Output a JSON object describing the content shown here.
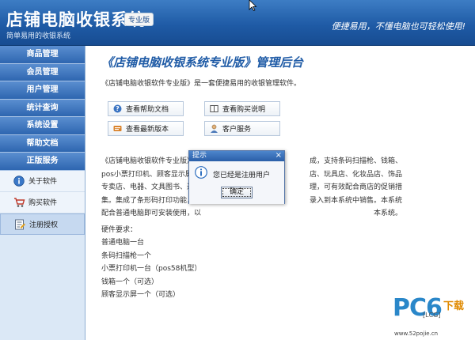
{
  "header": {
    "title": "店铺电脑收银系统",
    "edition": "专业版",
    "subtitle": "简单易用的收银系统",
    "slogan": "便捷易用，不懂电脑也可轻松使用!"
  },
  "sidebar": {
    "items": [
      {
        "label": "商品管理"
      },
      {
        "label": "会员管理"
      },
      {
        "label": "用户管理"
      },
      {
        "label": "统计查询"
      },
      {
        "label": "系统设置"
      },
      {
        "label": "帮助文档"
      },
      {
        "label": "正版服务"
      }
    ],
    "sub_items": [
      {
        "label": "关于软件",
        "icon": "info-icon"
      },
      {
        "label": "购买软件",
        "icon": "cart-icon"
      },
      {
        "label": "注册授权",
        "icon": "register-icon",
        "active": true
      }
    ]
  },
  "main": {
    "heading": "《店铺电脑收银系统专业版》管理后台",
    "intro": "《店铺电脑收银软件专业版》是一套便捷易用的收银管理软件。",
    "buttons": [
      {
        "label": "查看帮助文档",
        "icon": "help-doc-icon"
      },
      {
        "label": "查看购买说明",
        "icon": "book-icon"
      },
      {
        "label": "查看最新版本",
        "icon": "version-icon"
      },
      {
        "label": "客户服务",
        "icon": "customer-service-icon"
      }
    ],
    "description": [
      "《店铺电脑收银软件专业版》由",
      "pos小票打印机、顾客显示屏。",
      "专卖店、电器、文具图书、通讯",
      "集。集成了条形码打印功能，对",
      "配合普通电脑即可安装使用，以"
    ],
    "description_right": [
      "成，支持条码扫描枪、钱箱、",
      "店、玩具店、化妆品店、饰品",
      "理，可有效配合商店的促销措",
      "录入到本系统中销售。本系统",
      "本系统。"
    ],
    "hardware_title": "硬件要求：",
    "hardware_list": [
      "普通电脑一台",
      "条码扫描枪一个",
      "小票打印机一台（pos58机型）",
      "钱箱一个（可选）",
      "顾客显示屏一个（可选）"
    ]
  },
  "dialog": {
    "title": "提示",
    "close": "×",
    "message": "您已经是注册用户",
    "ok": "确定"
  },
  "watermark": {
    "brand": "PC6",
    "brand_cn": "下载",
    "tag": "[LCG]",
    "url": "www.52pojie.cn"
  },
  "colors": {
    "header_blue": "#1f5ba6",
    "nav_blue": "#2e66b0",
    "heading_blue": "#1f5ba6"
  }
}
